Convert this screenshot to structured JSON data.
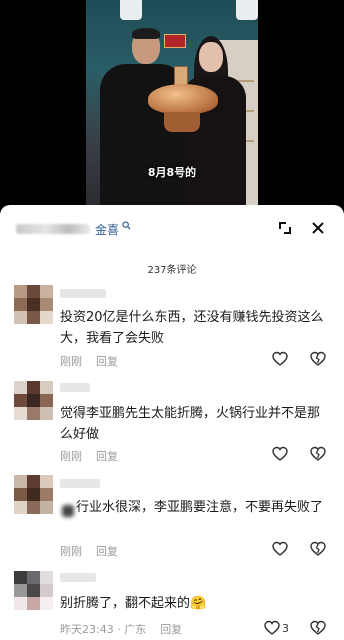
{
  "video": {
    "caption": "8月8号的"
  },
  "sheet": {
    "search_term": "金喜",
    "comment_count": "237条评论"
  },
  "comments": [
    {
      "text": "投资20亿是什么东西，还没有赚钱先投资这么大，我看了会失败",
      "time": "刚刚",
      "reply": "回复"
    },
    {
      "text": "觉得李亚鹏先生太能折腾，火锅行业并不是那么好做",
      "time": "刚刚",
      "reply": "回复"
    },
    {
      "text": "行业水很深，李亚鹏要注意，不要再失败了",
      "time": "刚刚",
      "reply": "回复"
    },
    {
      "text": "别折腾了，翻不起来的🤗",
      "time": "昨天23:43 · 广东",
      "reply": "回复",
      "likes": "3"
    }
  ],
  "icons": {
    "search": "search-icon",
    "collapse": "collapse-corner-icon",
    "close": "close-icon",
    "like": "heart-outline-icon",
    "dislike": "broken-heart-icon"
  },
  "colors": {
    "link_blue": "#2f5e93",
    "meta_gray": "#9a9a9a"
  }
}
